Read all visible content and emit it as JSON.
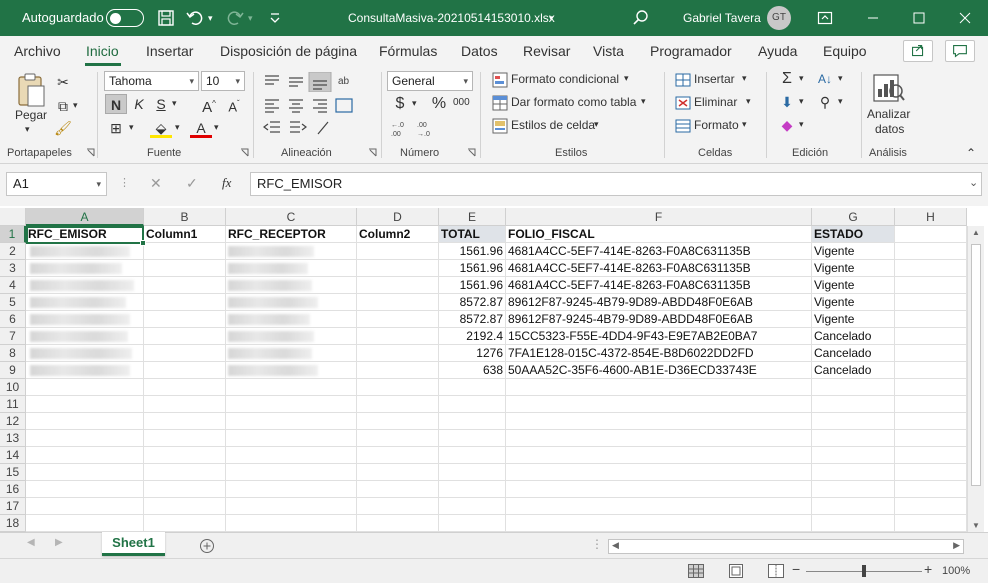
{
  "titlebar": {
    "autosave_label": "Autoguardado",
    "filename": "ConsultaMasiva-20210514153010.xlsx",
    "user_name": "Gabriel Tavera",
    "user_initials": "GT"
  },
  "ribbon_tabs": [
    "Archivo",
    "Inicio",
    "Insertar",
    "Disposición de página",
    "Fórmulas",
    "Datos",
    "Revisar",
    "Vista",
    "Programador",
    "Ayuda",
    "Equipo"
  ],
  "ribbon": {
    "portapapeles": {
      "label": "Portapapeles",
      "paste": "Pegar"
    },
    "fuente": {
      "label": "Fuente",
      "font_name": "Tahoma",
      "font_size": "10",
      "bold": "N",
      "italic": "K",
      "underline": "S"
    },
    "alineacion": {
      "label": "Alineación"
    },
    "numero": {
      "label": "Número",
      "format": "General",
      "currency": "$",
      "percent": "%",
      "thousands": "000"
    },
    "estilos": {
      "label": "Estilos",
      "conditional": "Formato condicional",
      "as_table": "Dar formato como tabla",
      "cell_styles": "Estilos de celda"
    },
    "celdas": {
      "label": "Celdas",
      "insert": "Insertar",
      "delete": "Eliminar",
      "format": "Formato"
    },
    "edicion": {
      "label": "Edición"
    },
    "analisis": {
      "label": "Análisis",
      "analyze_line1": "Analizar",
      "analyze_line2": "datos"
    }
  },
  "formula_bar": {
    "name_box": "A1",
    "content": "RFC_EMISOR",
    "fx": "fx"
  },
  "columns": [
    "A",
    "B",
    "C",
    "D",
    "E",
    "F",
    "G",
    "H"
  ],
  "headers": [
    "RFC_EMISOR",
    "Column1",
    "RFC_RECEPTOR",
    "Column2",
    "TOTAL",
    "FOLIO_FISCAL",
    "ESTADO"
  ],
  "rows": [
    {
      "total": "1561.96",
      "folio": "4681A4CC-5EF7-414E-8263-F0A8C631135B",
      "estado": "Vigente"
    },
    {
      "total": "1561.96",
      "folio": "4681A4CC-5EF7-414E-8263-F0A8C631135B",
      "estado": "Vigente"
    },
    {
      "total": "1561.96",
      "folio": "4681A4CC-5EF7-414E-8263-F0A8C631135B",
      "estado": "Vigente"
    },
    {
      "total": "8572.87",
      "folio": "89612F87-9245-4B79-9D89-ABDD48F0E6AB",
      "estado": "Vigente"
    },
    {
      "total": "8572.87",
      "folio": "89612F87-9245-4B79-9D89-ABDD48F0E6AB",
      "estado": "Vigente"
    },
    {
      "total": "2192.4",
      "folio": "15CC5323-F55E-4DD4-9F43-E9E7AB2E0BA7",
      "estado": "Cancelado"
    },
    {
      "total": "1276",
      "folio": "7FA1E128-015C-4372-854E-B8D6022DD2FD",
      "estado": "Cancelado"
    },
    {
      "total": "638",
      "folio": "50AAA52C-35F6-4600-AB1E-D36ECD33743E",
      "estado": "Cancelado"
    }
  ],
  "row_numbers": [
    "1",
    "2",
    "3",
    "4",
    "5",
    "6",
    "7",
    "8",
    "9",
    "10",
    "11",
    "12",
    "13",
    "14",
    "15",
    "16",
    "17",
    "18"
  ],
  "sheet_tab": "Sheet1",
  "status": {
    "zoom": "100%"
  },
  "colors": {
    "accent": "#217346",
    "header_band": "#dfe3e8"
  }
}
